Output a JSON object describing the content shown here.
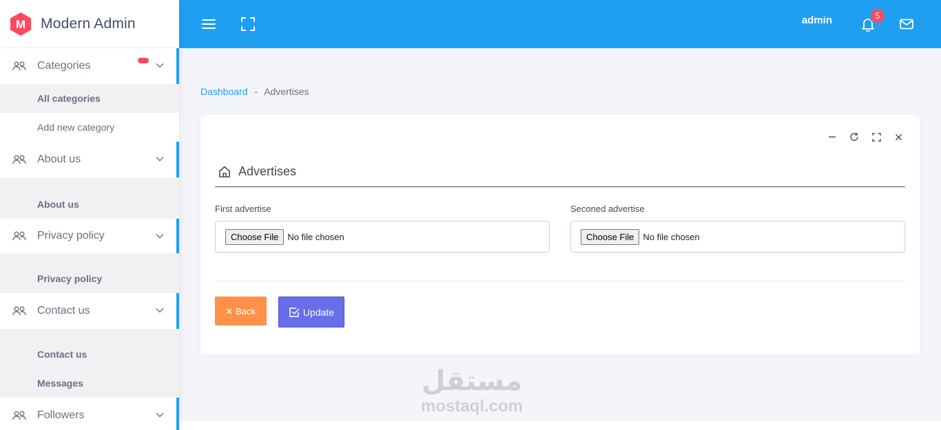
{
  "brand": {
    "logo_letter": "M",
    "name": "Modern Admin",
    "color": "#ff4961"
  },
  "topbar": {
    "user": "admin",
    "notification_count": "5",
    "bg": "#1e9ff2"
  },
  "sidebar": {
    "groups": [
      {
        "label": "Categories",
        "items": [
          "All categories",
          "Add new category"
        ]
      },
      {
        "label": "About us",
        "items": [
          "About us"
        ]
      },
      {
        "label": "Privacy policy",
        "items": [
          "Privacy policy"
        ]
      },
      {
        "label": "Contact us",
        "items": [
          "Contact us",
          "Messages"
        ]
      },
      {
        "label": "Followers",
        "items": []
      }
    ]
  },
  "breadcrumb": {
    "home": "Dashboard",
    "separator": "-",
    "current": "Advertises"
  },
  "card": {
    "title": "Advertises",
    "first_label": "First advertise",
    "second_label": "Seconed advertise",
    "choose_file": "Choose File",
    "no_file": "No file chosen",
    "back_label": "Back",
    "update_label": "Update"
  },
  "watermark": {
    "arabic": "مستقل",
    "latin": "mostaql.com"
  }
}
